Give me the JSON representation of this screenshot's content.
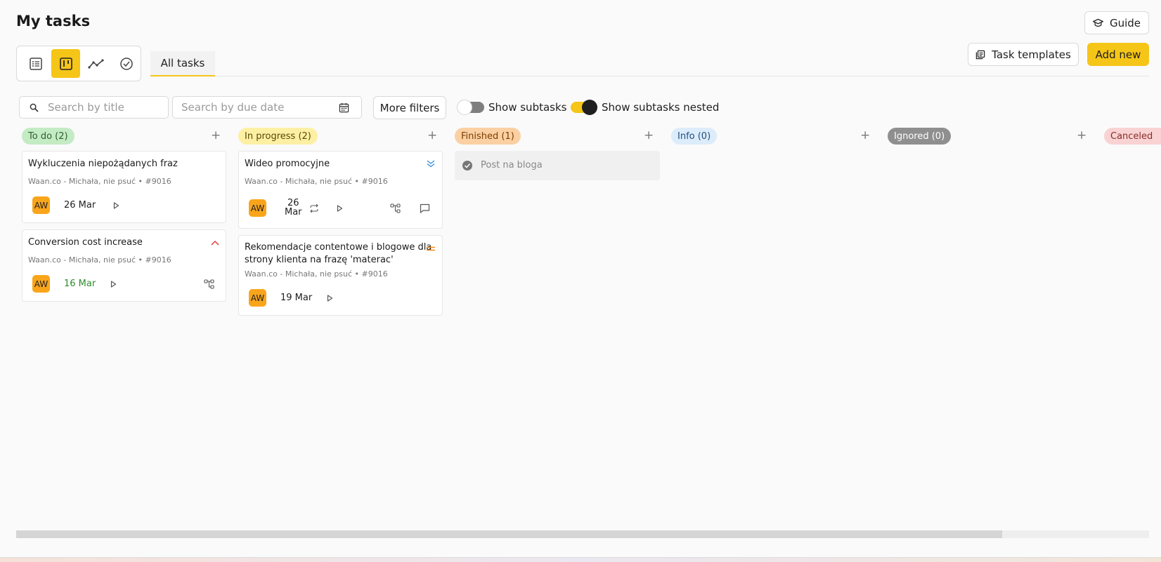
{
  "page": {
    "title": "My tasks"
  },
  "header": {
    "guide_label": "Guide",
    "templates_label": "Task templates",
    "add_new_label": "Add new"
  },
  "views": [
    "list-view",
    "board-view",
    "chart-view",
    "done-view"
  ],
  "tabs": {
    "all_tasks": "All tasks"
  },
  "filters": {
    "search_title_placeholder": "Search by title",
    "search_due_placeholder": "Search by due date",
    "more_filters_label": "More filters",
    "show_subtasks_label": "Show subtasks",
    "show_subtasks_nested_label": "Show subtasks nested",
    "show_subtasks_on": false,
    "show_subtasks_nested_on": true
  },
  "colors": {
    "accent": "#f5c518",
    "avatar": "#f9a51b"
  },
  "columns": [
    {
      "label": "To do (2)",
      "bg": "#c4ebc4",
      "fg": "#2e5e2e"
    },
    {
      "label": "In progress (2)",
      "bg": "#fdf0a4",
      "fg": "#5a4a00"
    },
    {
      "label": "Finished (1)",
      "bg": "#fbd0a3",
      "fg": "#7a3f00"
    },
    {
      "label": "Info (0)",
      "bg": "#dcecfb",
      "fg": "#1f4e79"
    },
    {
      "label": "Ignored (0)",
      "bg": "#8f8f8f",
      "fg": "#ffffff"
    },
    {
      "label": "Canceled",
      "bg": "#f9d3d3",
      "fg": "#8a2a2a"
    }
  ],
  "cards": {
    "todo1": {
      "title": "Wykluczenia niepożądanych fraz",
      "meta": "Waan.co - Michała, nie psuć  •  #9016",
      "avatar": "AW",
      "date": "26 Mar"
    },
    "todo2": {
      "title": "Conversion cost increase",
      "meta": "Waan.co - Michała, nie psuć  •  #9016",
      "avatar": "AW",
      "date": "16 Mar",
      "date_color": "#2e8b2e"
    },
    "prog1": {
      "title": "Wideo promocyjne",
      "meta": "Waan.co - Michała, nie psuć  •  #9016",
      "avatar": "AW",
      "date_day": "26",
      "date_month": "Mar"
    },
    "prog2": {
      "title_line1": "Rekomendacje contentowe i blogowe dla",
      "title_line2": "strony klienta na frazę 'materac'",
      "meta": "Waan.co - Michała, nie psuć  •  #9016",
      "avatar": "AW",
      "date": "19 Mar"
    },
    "fin1": {
      "title": "Post na bloga"
    }
  }
}
